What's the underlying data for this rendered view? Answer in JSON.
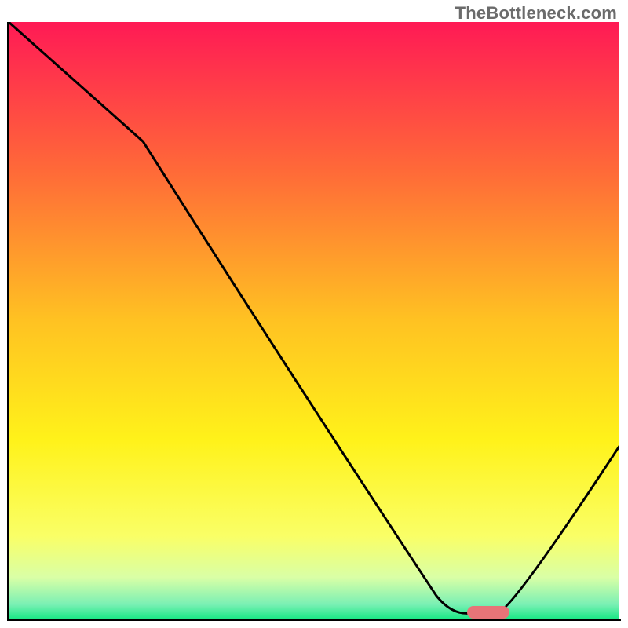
{
  "watermark": "TheBottleneck.com",
  "chart_data": {
    "type": "line",
    "title": "",
    "xlabel": "",
    "ylabel": "",
    "xlim": [
      0,
      100
    ],
    "ylim": [
      0,
      100
    ],
    "grid": false,
    "legend": false,
    "background_gradient": {
      "stops": [
        {
          "pos": 0.0,
          "color": "#ff1a55"
        },
        {
          "pos": 0.25,
          "color": "#ff6a38"
        },
        {
          "pos": 0.5,
          "color": "#ffc222"
        },
        {
          "pos": 0.7,
          "color": "#fff21a"
        },
        {
          "pos": 0.86,
          "color": "#faff66"
        },
        {
          "pos": 0.93,
          "color": "#d9ffa6"
        },
        {
          "pos": 0.975,
          "color": "#7af0b4"
        },
        {
          "pos": 1.0,
          "color": "#18e884"
        }
      ]
    },
    "series": [
      {
        "name": "bottleneck-curve",
        "color": "#000000",
        "x": [
          0,
          22,
          70,
          75,
          80,
          100
        ],
        "y": [
          100,
          80,
          4,
          1,
          1,
          29
        ]
      }
    ],
    "optimum_marker": {
      "x_start": 75,
      "x_end": 82,
      "y": 1.2,
      "color": "#e77478"
    }
  }
}
